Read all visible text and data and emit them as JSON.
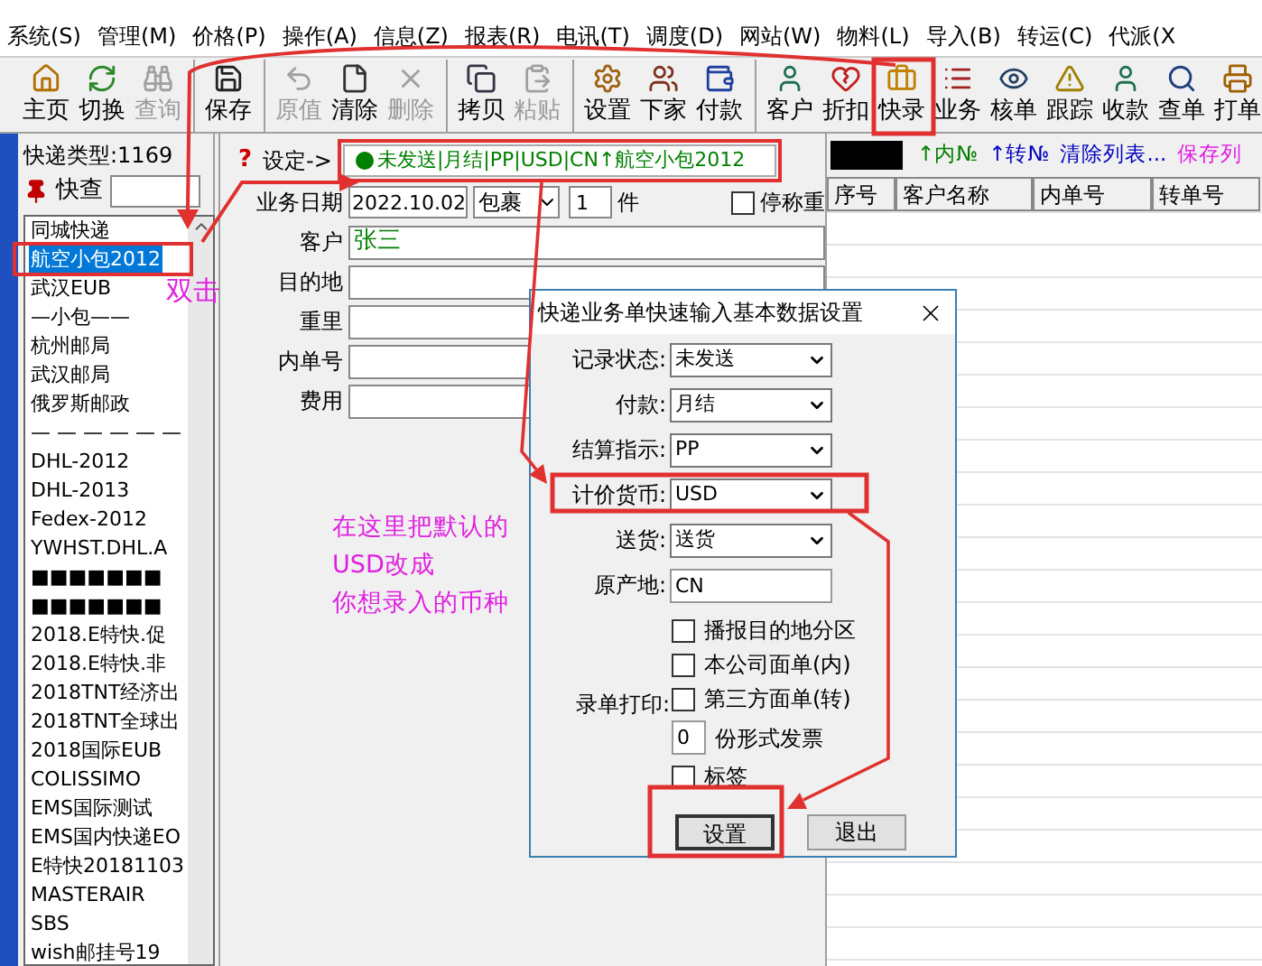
{
  "menu": [
    "系统(S)",
    "管理(M)",
    "价格(P)",
    "操作(A)",
    "信息(Z)",
    "报表(R)",
    "电讯(T)",
    "调度(D)",
    "网站(W)",
    "物料(L)",
    "导入(B)",
    "转运(C)",
    "代派(X"
  ],
  "toolbar": [
    [
      {
        "label": "主页",
        "disabled": false
      },
      {
        "label": "切换",
        "disabled": false
      },
      {
        "label": "查询",
        "disabled": true
      }
    ],
    [
      {
        "label": "保存",
        "disabled": false
      }
    ],
    [
      {
        "label": "原值",
        "disabled": true
      },
      {
        "label": "清除",
        "disabled": false
      },
      {
        "label": "删除",
        "disabled": true
      }
    ],
    [
      {
        "label": "拷贝",
        "disabled": false
      },
      {
        "label": "粘贴",
        "disabled": true
      }
    ],
    [
      {
        "label": "设置",
        "disabled": false
      },
      {
        "label": "下家",
        "disabled": false
      },
      {
        "label": "付款",
        "disabled": false
      }
    ],
    [
      {
        "label": "客户",
        "disabled": false
      },
      {
        "label": "折扣",
        "disabled": false
      },
      {
        "label": "快录",
        "disabled": false
      },
      {
        "label": "业务",
        "disabled": false
      },
      {
        "label": "核单",
        "disabled": false
      },
      {
        "label": "跟踪",
        "disabled": false
      },
      {
        "label": "收款",
        "disabled": false
      },
      {
        "label": "查单",
        "disabled": false
      },
      {
        "label": "打单",
        "disabled": false
      }
    ]
  ],
  "left_panel": {
    "type_label": "快递类型:1169",
    "search_label": "快查",
    "list": [
      {
        "label": "同城快递",
        "selected": false
      },
      {
        "label": "航空小包2012",
        "selected": true
      },
      {
        "label": "武汉EUB",
        "selected": false
      },
      {
        "label": "—小包——",
        "selected": false
      },
      {
        "label": "杭州邮局",
        "selected": false
      },
      {
        "label": "武汉邮局",
        "selected": false
      },
      {
        "label": "俄罗斯邮政",
        "selected": false
      },
      {
        "label": "— — — — — —",
        "selected": false
      },
      {
        "label": "DHL-2012",
        "selected": false
      },
      {
        "label": "DHL-2013",
        "selected": false
      },
      {
        "label": "Fedex-2012",
        "selected": false
      },
      {
        "label": "YWHST.DHL.A",
        "selected": false
      },
      {
        "label": "■■■■■■■",
        "selected": false
      },
      {
        "label": "■■■■■■■",
        "selected": false
      },
      {
        "label": "2018.E特快.促",
        "selected": false
      },
      {
        "label": "2018.E特快.非",
        "selected": false
      },
      {
        "label": "2018TNT经济出",
        "selected": false
      },
      {
        "label": "2018TNT全球出",
        "selected": false
      },
      {
        "label": "2018国际EUB",
        "selected": false
      },
      {
        "label": "COLISSIMO",
        "selected": false
      },
      {
        "label": "EMS国际测试",
        "selected": false
      },
      {
        "label": "EMS国内快递EO",
        "selected": false
      },
      {
        "label": "E特快20181103",
        "selected": false
      },
      {
        "label": "MASTERAIR",
        "selected": false
      },
      {
        "label": "SBS",
        "selected": false
      },
      {
        "label": "wish邮挂号19",
        "selected": false
      }
    ]
  },
  "form": {
    "help_mark": "?",
    "settings_label": "设定->",
    "settings_summary": "未发送|月结|PP|USD|CN↑航空小包2012",
    "links": [
      {
        "label": "↑内№",
        "color": "#008000"
      },
      {
        "label": "↑转№",
        "color": "#0000c0"
      },
      {
        "label": "清除列表...",
        "color": "#0000c0"
      },
      {
        "label": "保存列",
        "color": "#e020e0"
      }
    ],
    "date_label": "业务日期",
    "date": "2022.10.02",
    "package": "包裹",
    "count": "1",
    "unit": "件",
    "stop_weigh": {
      "label": "停称重",
      "checked": false
    },
    "fields": [
      {
        "label": "客户",
        "value": "张三"
      },
      {
        "label": "目的地"
      },
      {
        "label": "重里"
      },
      {
        "label": "内单号"
      },
      {
        "label": "费用"
      }
    ]
  },
  "table": {
    "columns": [
      "序号",
      "客户名称",
      "内单号",
      "转单号"
    ]
  },
  "dialog": {
    "title": "快递业务单快速输入基本数据设置",
    "fields": [
      {
        "kind": "select",
        "label": "记录状态:",
        "value": "未发送"
      },
      {
        "kind": "select",
        "label": "付款:",
        "value": "月结"
      },
      {
        "kind": "select",
        "label": "结算指示:",
        "value": "PP"
      },
      {
        "kind": "select",
        "label": "计价货币:",
        "value": "USD"
      },
      {
        "kind": "select",
        "label": "送货:",
        "value": "送货"
      },
      {
        "kind": "text",
        "label": "原产地:",
        "value": "CN"
      }
    ],
    "print_label": "录单打印:",
    "print_options": [
      {
        "kind": "checkbox",
        "label": "播报目的地分区",
        "checked": false
      },
      {
        "kind": "checkbox",
        "label": "本公司面单(内)",
        "checked": false
      },
      {
        "kind": "checkbox",
        "label": "第三方面单(转)",
        "checked": false
      },
      {
        "kind": "number",
        "value": "0",
        "unit": "份形式发票"
      },
      {
        "kind": "checkbox",
        "label": "标签",
        "checked": false
      }
    ],
    "buttons": [
      "设置",
      "退出"
    ]
  },
  "annotations": {
    "double_click": "双击",
    "note": [
      "在这里把默认的",
      "USD改成",
      "你想录入的币种"
    ]
  }
}
